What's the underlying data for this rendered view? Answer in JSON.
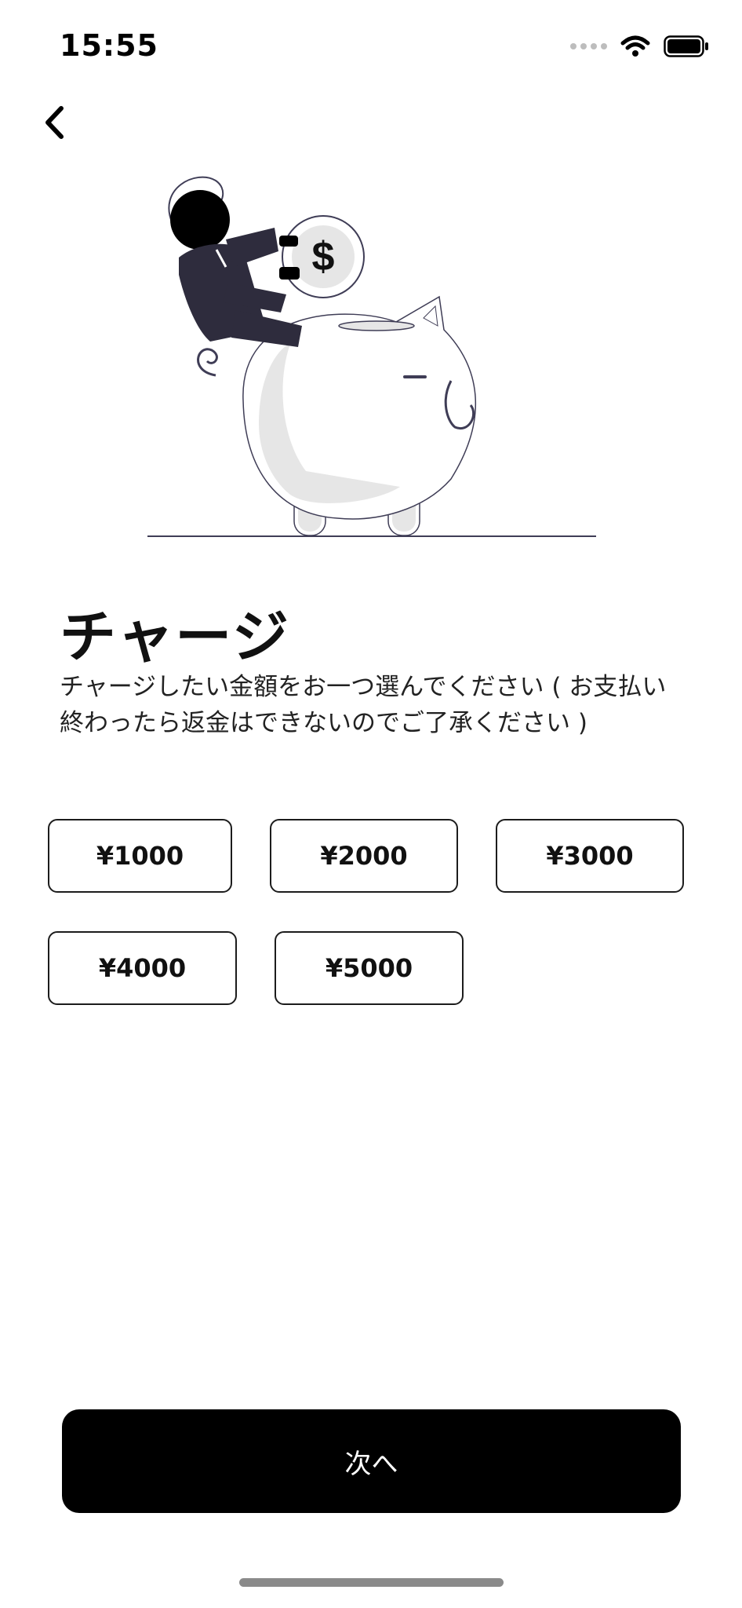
{
  "status": {
    "time": "15:55"
  },
  "nav": {
    "back_icon": "chevron-left-icon"
  },
  "illustration": {
    "name": "piggy-bank-illustration",
    "coin_symbol": "$"
  },
  "page": {
    "title": "チャージ",
    "description": "チャージしたい金額をお一つ選んでください ( お支払い終わったら返金はできないのでご了承ください )"
  },
  "amounts": [
    {
      "label": "¥1000"
    },
    {
      "label": "¥2000"
    },
    {
      "label": "¥3000"
    },
    {
      "label": "¥4000"
    },
    {
      "label": "¥5000"
    }
  ],
  "footer": {
    "next_label": "次へ"
  },
  "colors": {
    "primary": "#000000",
    "illustration_dark": "#2e2c3d",
    "illustration_light": "#e6e6e6"
  }
}
